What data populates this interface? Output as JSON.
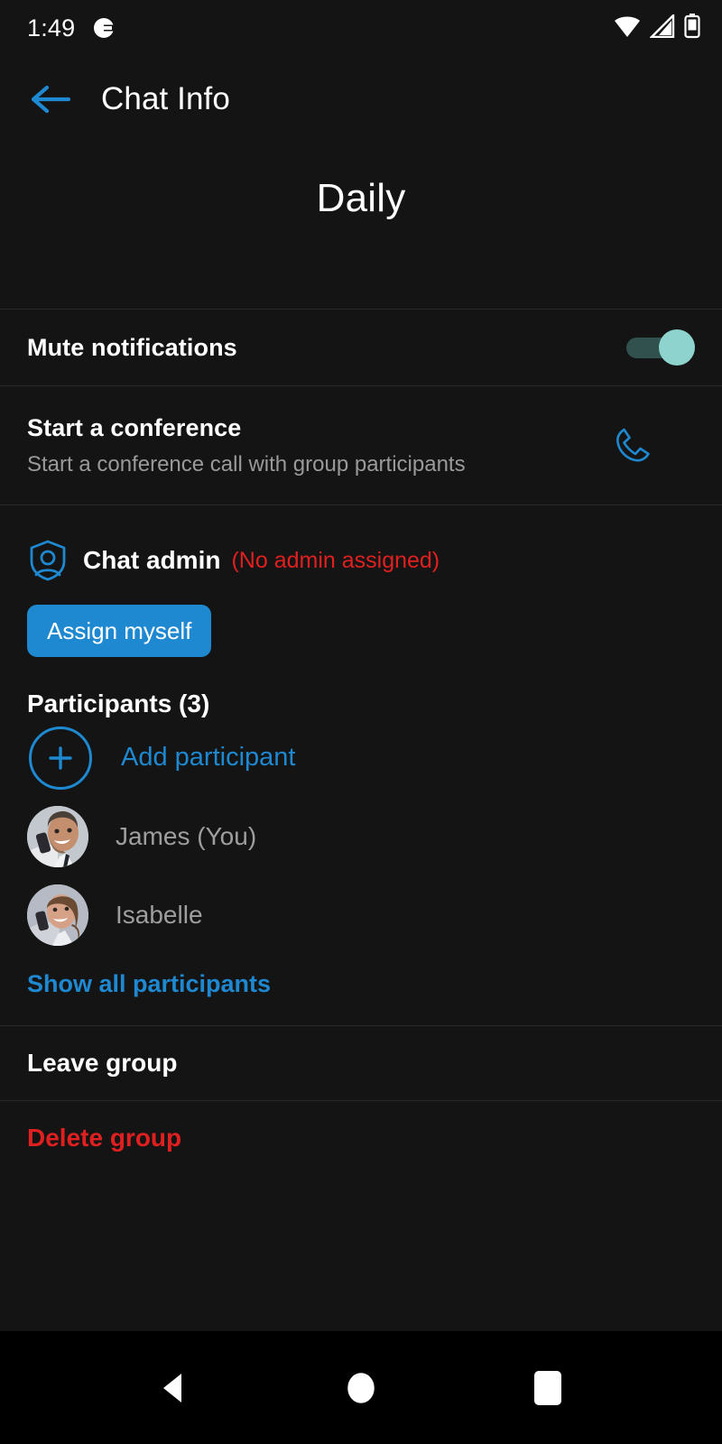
{
  "status_bar": {
    "time": "1:49",
    "notification_icon": "app-notification-icon",
    "wifi_icon": "wifi-icon",
    "signal_icon": "cellular-signal-icon",
    "battery_icon": "battery-icon"
  },
  "app_bar": {
    "back_icon": "back-arrow-icon",
    "title": "Chat Info"
  },
  "group": {
    "name": "Daily"
  },
  "mute": {
    "label": "Mute notifications",
    "enabled": true
  },
  "conference": {
    "title": "Start a conference",
    "subtitle": "Start a conference call with group participants",
    "call_icon": "phone-call-icon"
  },
  "admin": {
    "shield_icon": "shield-person-icon",
    "label": "Chat admin",
    "status": "(No admin assigned)",
    "assign_button": "Assign myself"
  },
  "participants": {
    "heading": "Participants (3)",
    "count": 3,
    "add_label": "Add participant",
    "add_icon": "plus-circle-icon",
    "items": [
      {
        "name": "James (You)",
        "avatar": "photo-man-on-phone"
      },
      {
        "name": "Isabelle",
        "avatar": "photo-woman-on-phone"
      }
    ],
    "show_all_label": "Show all participants"
  },
  "actions": {
    "leave": "Leave group",
    "delete": "Delete group"
  },
  "nav_bar": {
    "back": "nav-back-icon",
    "home": "nav-home-icon",
    "recents": "nav-recents-icon"
  },
  "colors": {
    "accent_blue": "#1e88d0",
    "danger_red": "#e02020",
    "toggle_on": "#8ed3ce",
    "background": "#141414"
  }
}
